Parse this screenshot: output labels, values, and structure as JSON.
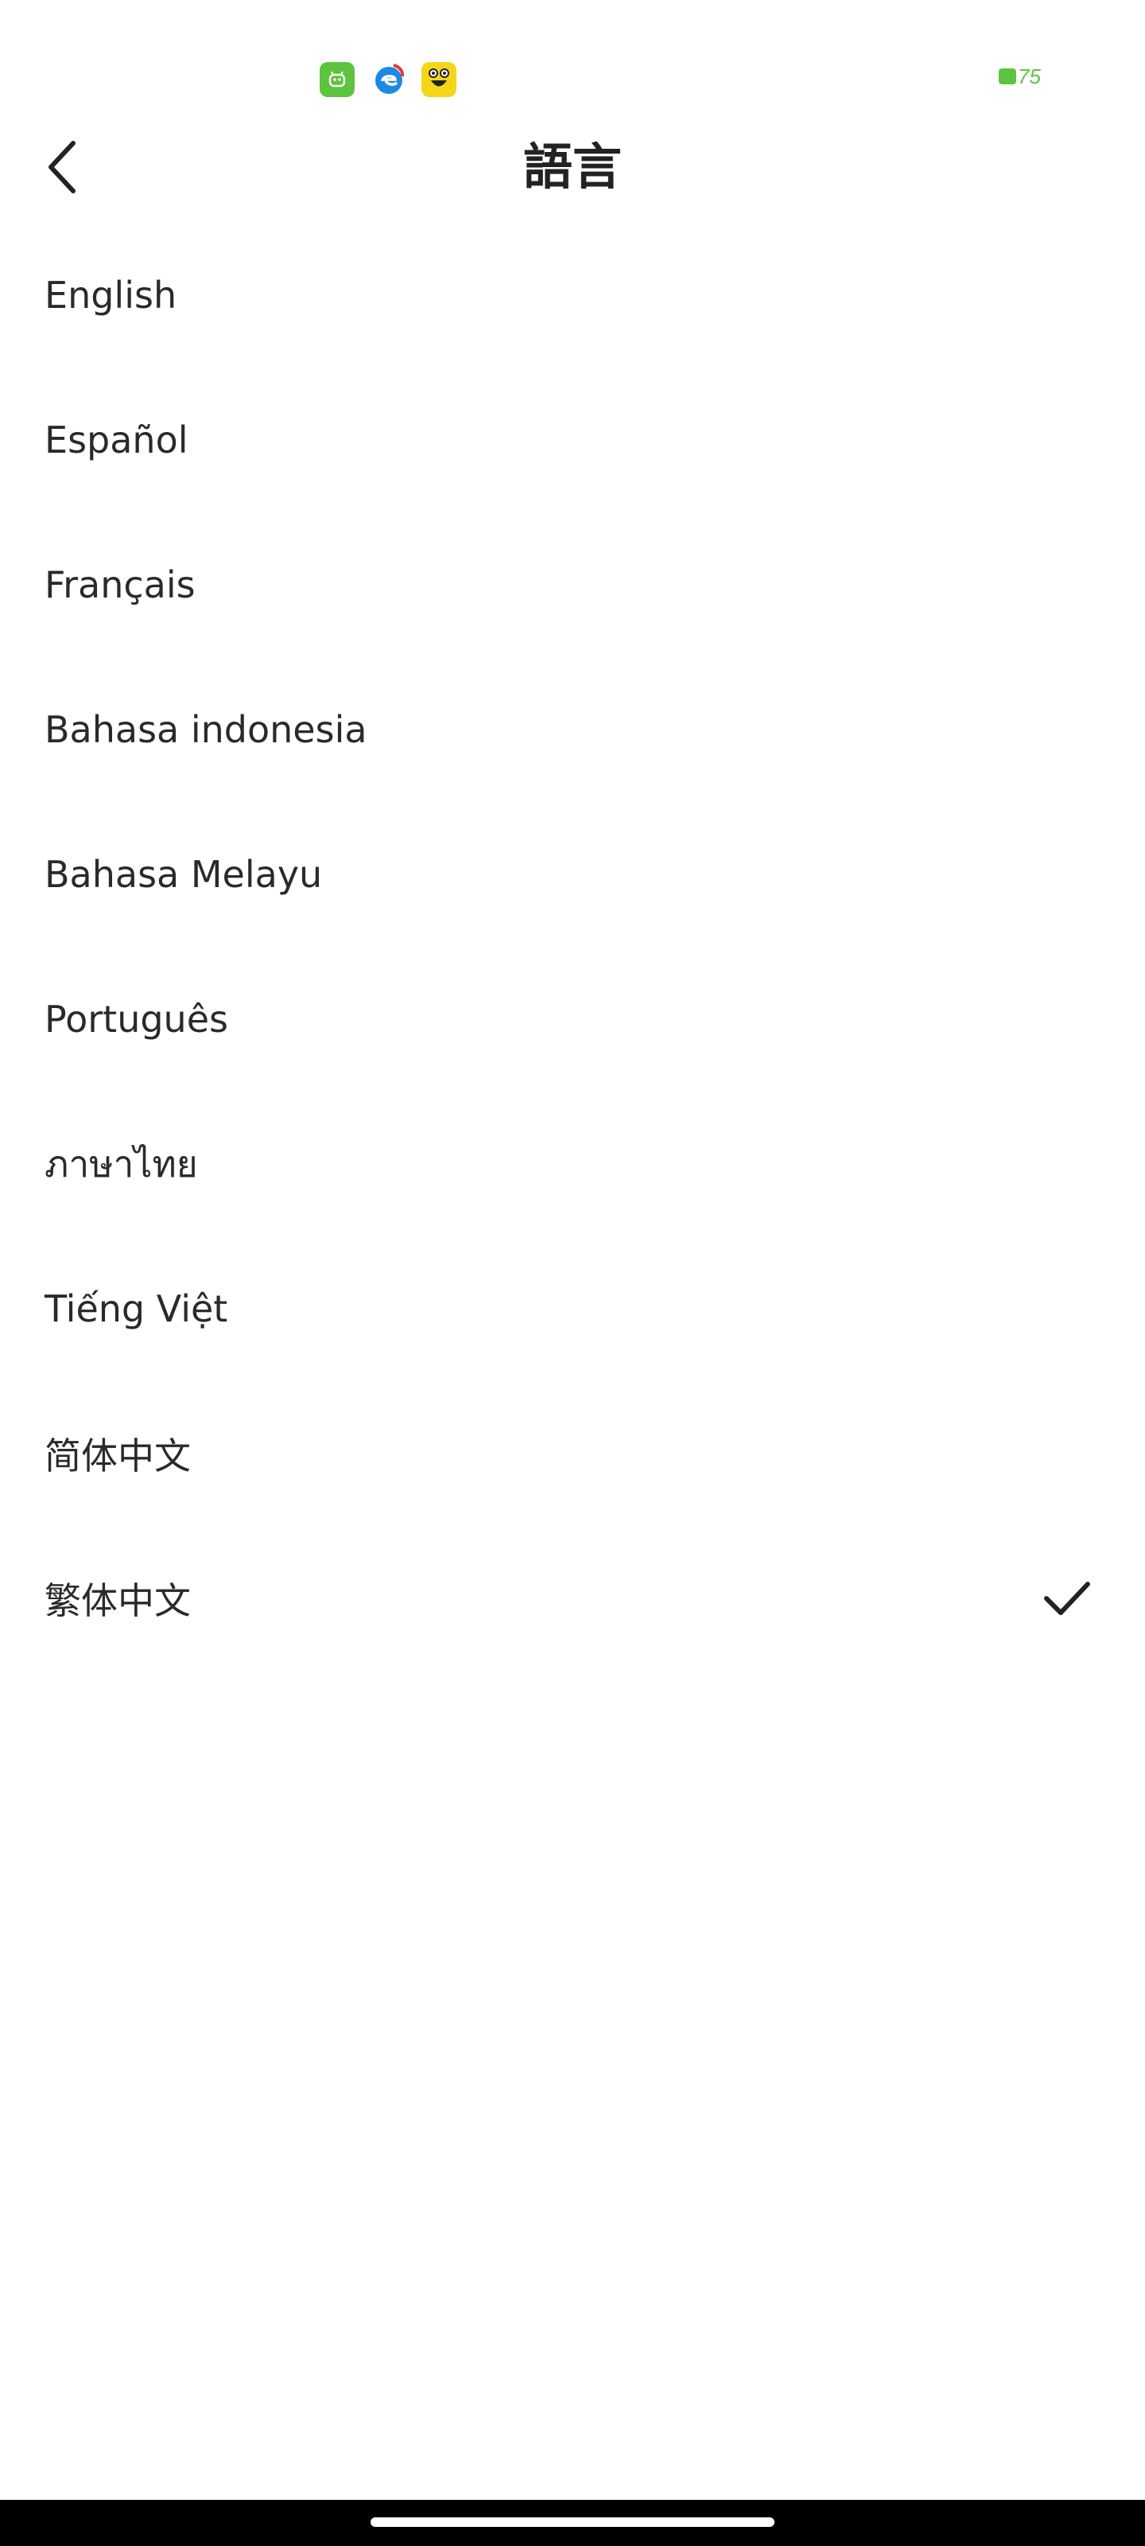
{
  "status_bar": {
    "notifications": [
      {
        "icon": "robot-app-icon",
        "color": "#5cc43e"
      },
      {
        "icon": "browser-app-icon",
        "color": "#1e88e5"
      },
      {
        "icon": "smiley-app-icon",
        "color": "#f3d617"
      }
    ],
    "battery_text": "75",
    "battery_color": "#5cc43e"
  },
  "header": {
    "back_icon": "chevron-left-icon",
    "title": "語言"
  },
  "languages": [
    {
      "label": "English",
      "selected": false
    },
    {
      "label": "Español",
      "selected": false
    },
    {
      "label": "Français",
      "selected": false
    },
    {
      "label": "Bahasa indonesia",
      "selected": false
    },
    {
      "label": "Bahasa Melayu",
      "selected": false
    },
    {
      "label": "Português",
      "selected": false
    },
    {
      "label": "ภาษาไทย",
      "selected": false
    },
    {
      "label": "Tiếng Việt",
      "selected": false
    },
    {
      "label": "简体中文",
      "selected": false
    },
    {
      "label": "繁体中文",
      "selected": true
    }
  ],
  "selected_icon": "checkmark-icon"
}
